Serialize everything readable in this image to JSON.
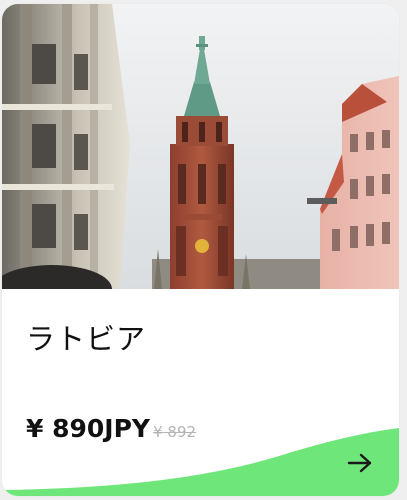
{
  "product": {
    "title": "ラトビア",
    "price": "¥ 890JPY",
    "original_price": "¥ 892",
    "image": "Riga street view with red-brick church spire",
    "arrow_icon": "arrow-right-icon",
    "accent_color": "#6ee67a"
  }
}
